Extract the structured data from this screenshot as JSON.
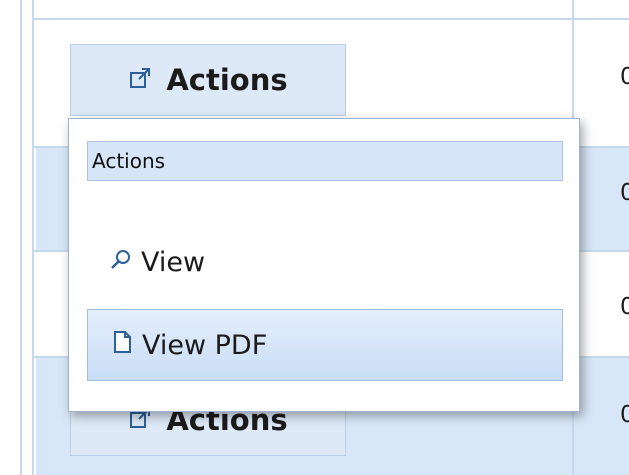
{
  "grid": {
    "rows": [
      {
        "action_label": "Actions",
        "number": "0",
        "selected": false
      },
      {
        "action_label": "",
        "number": "0",
        "selected": true
      },
      {
        "action_label": "",
        "number": "0",
        "selected": false
      },
      {
        "action_label": "Actions",
        "number": "0",
        "selected": true
      }
    ]
  },
  "menu": {
    "header": "Actions",
    "items": [
      {
        "label": "View",
        "icon": "magnifier-icon"
      },
      {
        "label": "View PDF",
        "icon": "document-icon"
      }
    ]
  },
  "colors": {
    "grid_line": "#c5d8ee",
    "row_selected": "#d8e7f7",
    "button_bg": "#dde9f7",
    "menu_highlight": "#c9def6"
  }
}
